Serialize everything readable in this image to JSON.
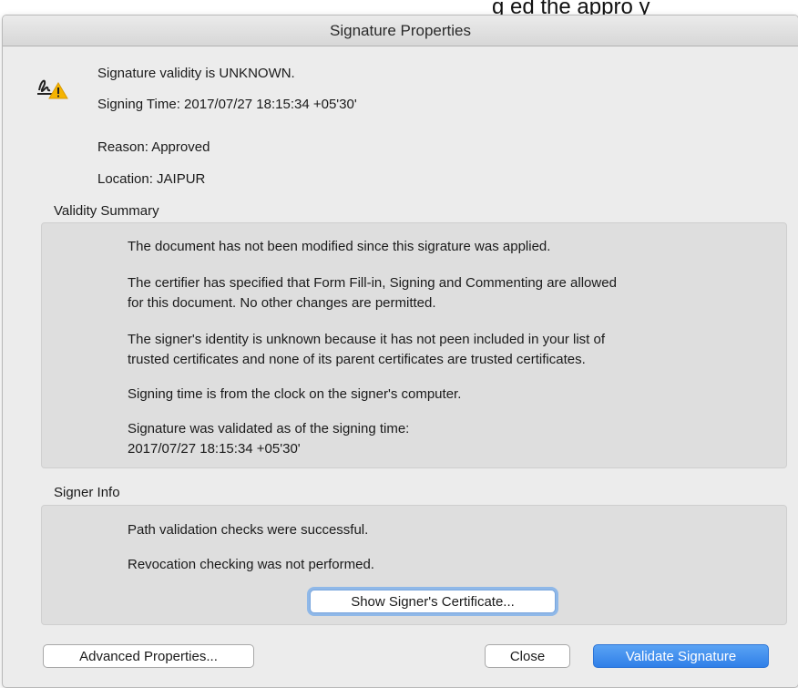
{
  "background_text": "g                    ed  the  appro     y",
  "window": {
    "title": "Signature Properties"
  },
  "header": {
    "validity": "Signature validity is UNKNOWN.",
    "signing_time": "Signing Time:  2017/07/27 18:15:34 +05'30'",
    "reason": "Reason:  Approved",
    "location": "Location:  JAIPUR"
  },
  "validity_summary": {
    "label": "Validity Summary",
    "lines": [
      "The document has not been modified since this sigrature was applied.",
      "The certifier has specified that Form Fill-in, Signing and Commenting are allowed",
      "for this document. No other changes are permitted.",
      "The signer's identity is unknown because it has not peen included in your list of",
      "trusted certificates and none of its parent certificates are trusted certificates.",
      "Signing time is from the clock on the signer's computer.",
      "Signature was validated as of the signing time:",
      "2017/07/27 18:15:34 +05'30'"
    ]
  },
  "signer_info": {
    "label": "Signer Info",
    "lines": [
      "Path validation checks were successful.",
      "Revocation checking was not performed."
    ],
    "show_certificate_label": "Show Signer's Certificate..."
  },
  "footer": {
    "advanced_label": "Advanced Properties...",
    "close_label": "Close",
    "validate_label": "Validate Signature"
  },
  "icons": {
    "signature_status": "signature-warning-icon"
  },
  "colors": {
    "warning": "#f5b400",
    "primary_button": "#2f7fe8"
  }
}
